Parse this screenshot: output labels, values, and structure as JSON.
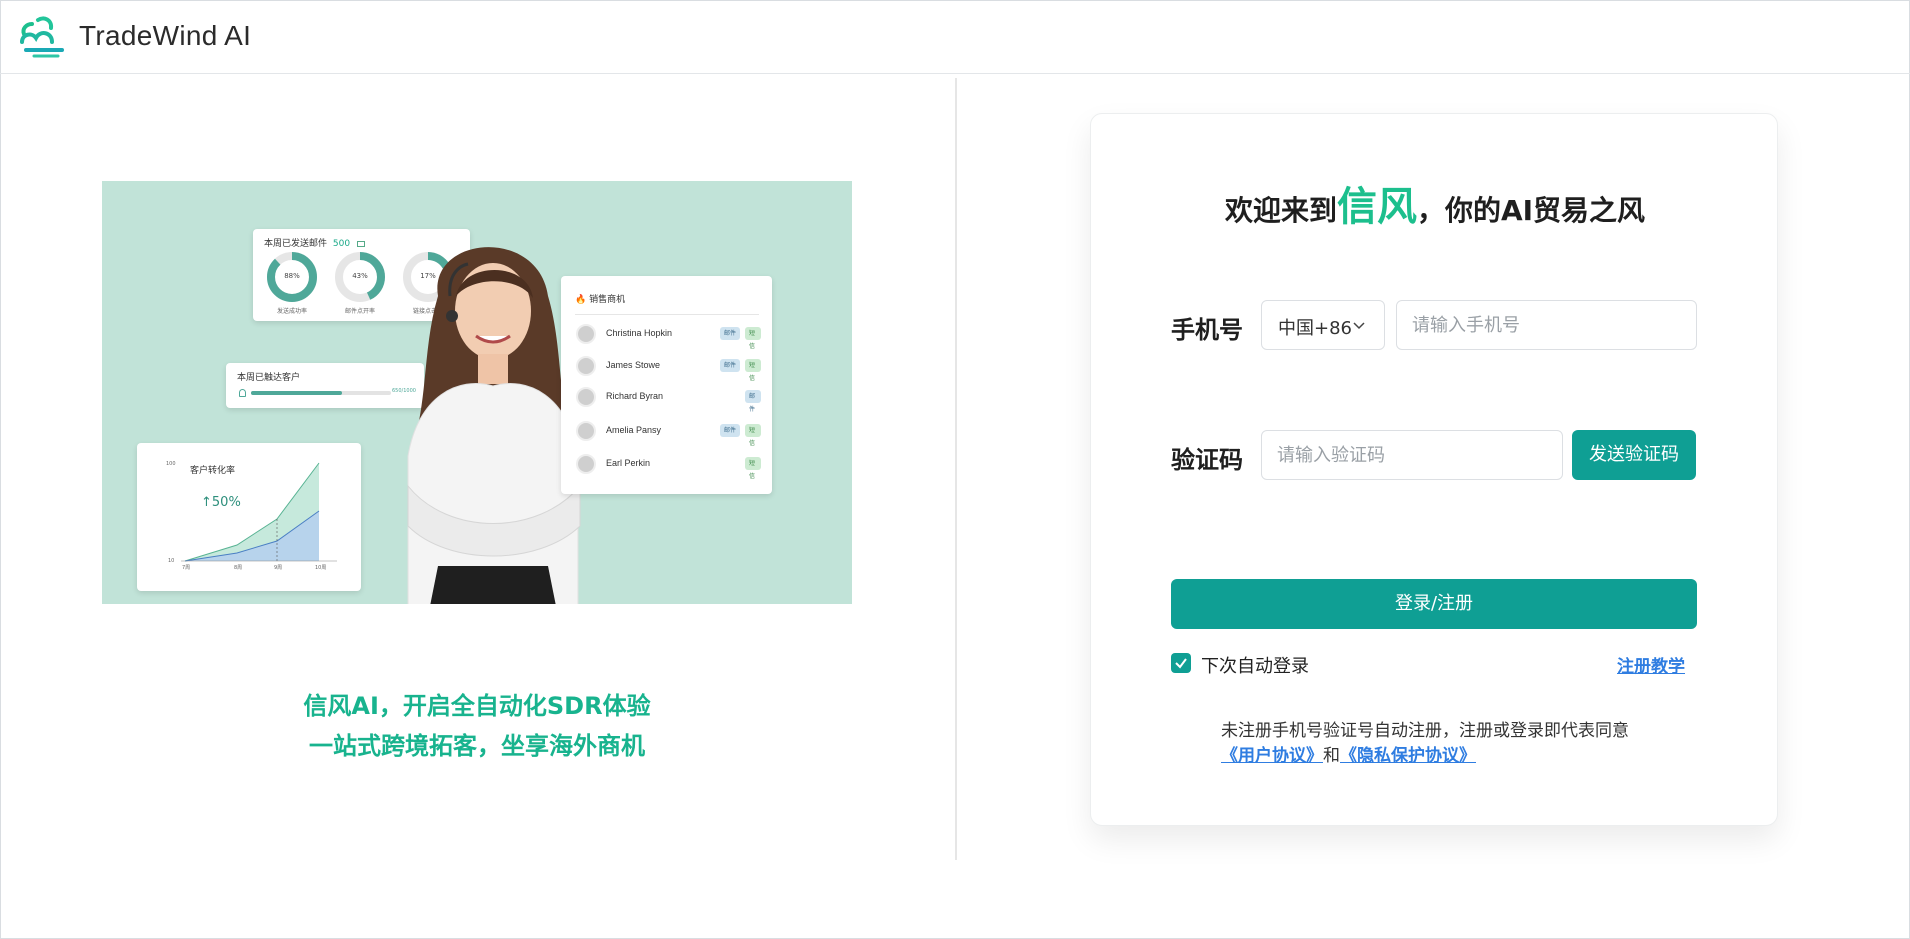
{
  "header": {
    "brand": "TradeWind AI",
    "logo_icon": "wind-cloud-logo-icon"
  },
  "illustration": {
    "emails_card": {
      "title": "本周已发送邮件",
      "count": "500",
      "mail_icon": "mail-icon",
      "donuts": [
        {
          "value": "88%",
          "label": "发送成功率",
          "percent": 88
        },
        {
          "value": "43%",
          "label": "邮件点开率",
          "percent": 43
        },
        {
          "value": "17%",
          "label": "链接点击率",
          "percent": 17
        }
      ]
    },
    "reach_card": {
      "title": "本周已触达客户",
      "progress_text": "650/1000",
      "progress": 0.65
    },
    "conversion_card": {
      "title": "客户转化率",
      "growth": "50%",
      "y_max": "100",
      "y_min": "10",
      "x_labels": [
        "7周",
        "8周",
        "9周",
        "10周"
      ]
    },
    "sales_card": {
      "title": "销售商机",
      "rows": [
        {
          "name": "Christina Hopkin",
          "tags": [
            "邮件",
            "短信"
          ]
        },
        {
          "name": "James Stowe",
          "tags": [
            "邮件",
            "短信"
          ]
        },
        {
          "name": "Richard Byran",
          "tags": [
            "邮件"
          ]
        },
        {
          "name": "Amelia Pansy",
          "tags": [
            "邮件",
            "短信"
          ]
        },
        {
          "name": "Earl Perkin",
          "tags": [
            "短信"
          ]
        }
      ]
    }
  },
  "slogan": {
    "line1": "信风AI，开启全自动化SDR体验",
    "line2": "一站式跨境拓客，坐享海外商机"
  },
  "login": {
    "welcome_prefix": "欢迎来到",
    "welcome_accent": "信风",
    "welcome_suffix": "，你的AI贸易之风",
    "phone_label": "手机号",
    "country_code": "中国+86",
    "phone_placeholder": "请输入手机号",
    "code_label": "验证码",
    "code_placeholder": "请输入验证码",
    "send_code": "发送验证码",
    "submit": "登录/注册",
    "remember_label": "下次自动登录",
    "remember_checked": true,
    "tutorial": "注册教学",
    "agreement_text": "未注册手机号验证号自动注册，注册或登录即代表同意",
    "user_agreement": "《用户协议》",
    "and": "和",
    "privacy_agreement": "《隐私保护协议》"
  },
  "colors": {
    "accent": "#0f9f94",
    "brand_green": "#1cbf8d",
    "link": "#2f7de1",
    "illustration_bg": "#c1e3d8"
  }
}
